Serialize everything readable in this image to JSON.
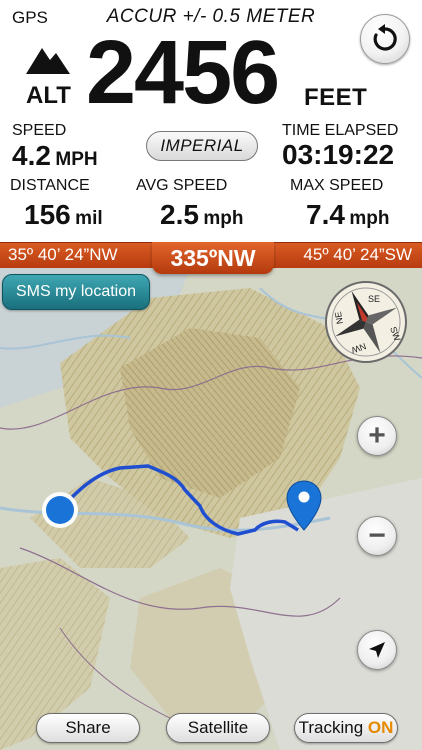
{
  "header": {
    "gps_label": "GPS",
    "accuracy": "ACCUR +/- 0.5 METER"
  },
  "altitude": {
    "label": "ALT",
    "value": "2456",
    "unit": "FEET"
  },
  "speed": {
    "label": "SPEED",
    "value": "4.2",
    "unit": "MPH"
  },
  "units_toggle": {
    "label": "IMPERIAL"
  },
  "time_elapsed": {
    "label": "TIME ELAPSED",
    "value": "03:19:22"
  },
  "distance": {
    "label": "DISTANCE",
    "value": "156",
    "unit": "mil"
  },
  "avg_speed": {
    "label": "AVG SPEED",
    "value": "2.5",
    "unit": "mph"
  },
  "max_speed": {
    "label": "MAX SPEED",
    "value": "7.4",
    "unit": "mph"
  },
  "heading": {
    "left": "35º 40’ 24”NW",
    "center": "335ºNW",
    "right": "45º 40’ 24”SW"
  },
  "map": {
    "sms_label": "SMS my location",
    "compass_letters": [
      "SE",
      "SW",
      "NW",
      "NE"
    ],
    "zoom_in": "+",
    "zoom_out": "−"
  },
  "bottom_bar": {
    "share": "Share",
    "satellite": "Satellite",
    "tracking_label": "Tracking",
    "tracking_state": "ON"
  },
  "colors": {
    "heading_bar": "#c84a17",
    "sms_button": "#2a8c98",
    "route": "#1f4fd0",
    "marker": "#1a74d8",
    "tracking_on": "#e58a00"
  },
  "icons": [
    "reset-icon",
    "mountain-icon",
    "compass-icon",
    "location-arrow-icon",
    "start-dot-icon",
    "destination-pin-icon"
  ]
}
